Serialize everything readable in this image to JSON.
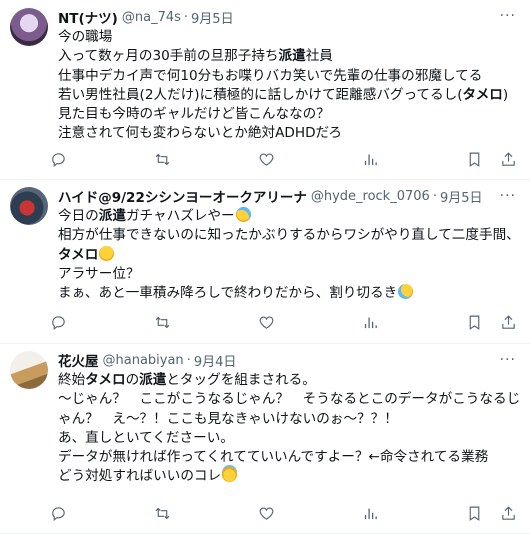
{
  "tweets": [
    {
      "name": "NT(ナツ)",
      "handle": "@na_74s",
      "dot": "·",
      "time": "9月5日",
      "more": "···",
      "lines": [
        [
          "今の職場"
        ],
        [
          "入って数ヶ月の30手前の旦那子持ち",
          "派遣",
          "社員"
        ],
        [
          "仕事中デカイ声で何10分もお喋りバカ笑いで先輩の仕事の邪魔してる"
        ],
        [
          "若い男性社員(2人だけ)に積極的に話しかけて距離感バグってるし(",
          "タメロ",
          ")"
        ],
        [
          "見た目も今時のギャルだけど皆こんななの？"
        ],
        [
          "注意されて何も変わらないとか絶対ADHDだろ"
        ]
      ]
    },
    {
      "name": "ハイド@9/22シシンヨーオークアリーナ",
      "handle": "@hyde_rock_0706",
      "dot": "·",
      "time": "9月5日",
      "more": "···",
      "lines": [
        [
          "今日の",
          "派遣",
          "ガチャハズレやー"
        ],
        [
          "相方が仕事できないのに知ったかぶりするからワシがやり直して二度手間、"
        ],
        [
          "",
          "タメロ",
          ""
        ],
        [
          "アラサー位？"
        ],
        [
          "まぁ、あと一車積み降ろしで終わりだから、割り切るき"
        ]
      ]
    },
    {
      "name": "花火屋",
      "handle": "@hanabiyan",
      "dot": "·",
      "time": "9月4日",
      "more": "···",
      "lines": [
        [
          "終始",
          "タメロ",
          "の"
        ],
        [
          "",
          "派遣",
          "とタッグを組まされる。"
        ],
        [
          "〜じゃん？　ここがこうなるじゃん？　そうなるとこのデータがこうなるじ"
        ],
        [
          "ゃん？　え〜？！ここも見なきゃいけないのぉ〜？？！"
        ],
        [
          "あ、直しといてくださーい。"
        ],
        [
          "データが無ければ作ってくれてていいんですよー？←命令されてる業務"
        ],
        [
          "どう対処すればいいのコレ"
        ]
      ]
    }
  ],
  "actions": {
    "reply_icon": "reply-icon",
    "retweet_icon": "retweet-icon",
    "like_icon": "heart-icon",
    "views_icon": "views-icon",
    "bookmark_icon": "bookmark-icon",
    "share_icon": "share-icon"
  }
}
